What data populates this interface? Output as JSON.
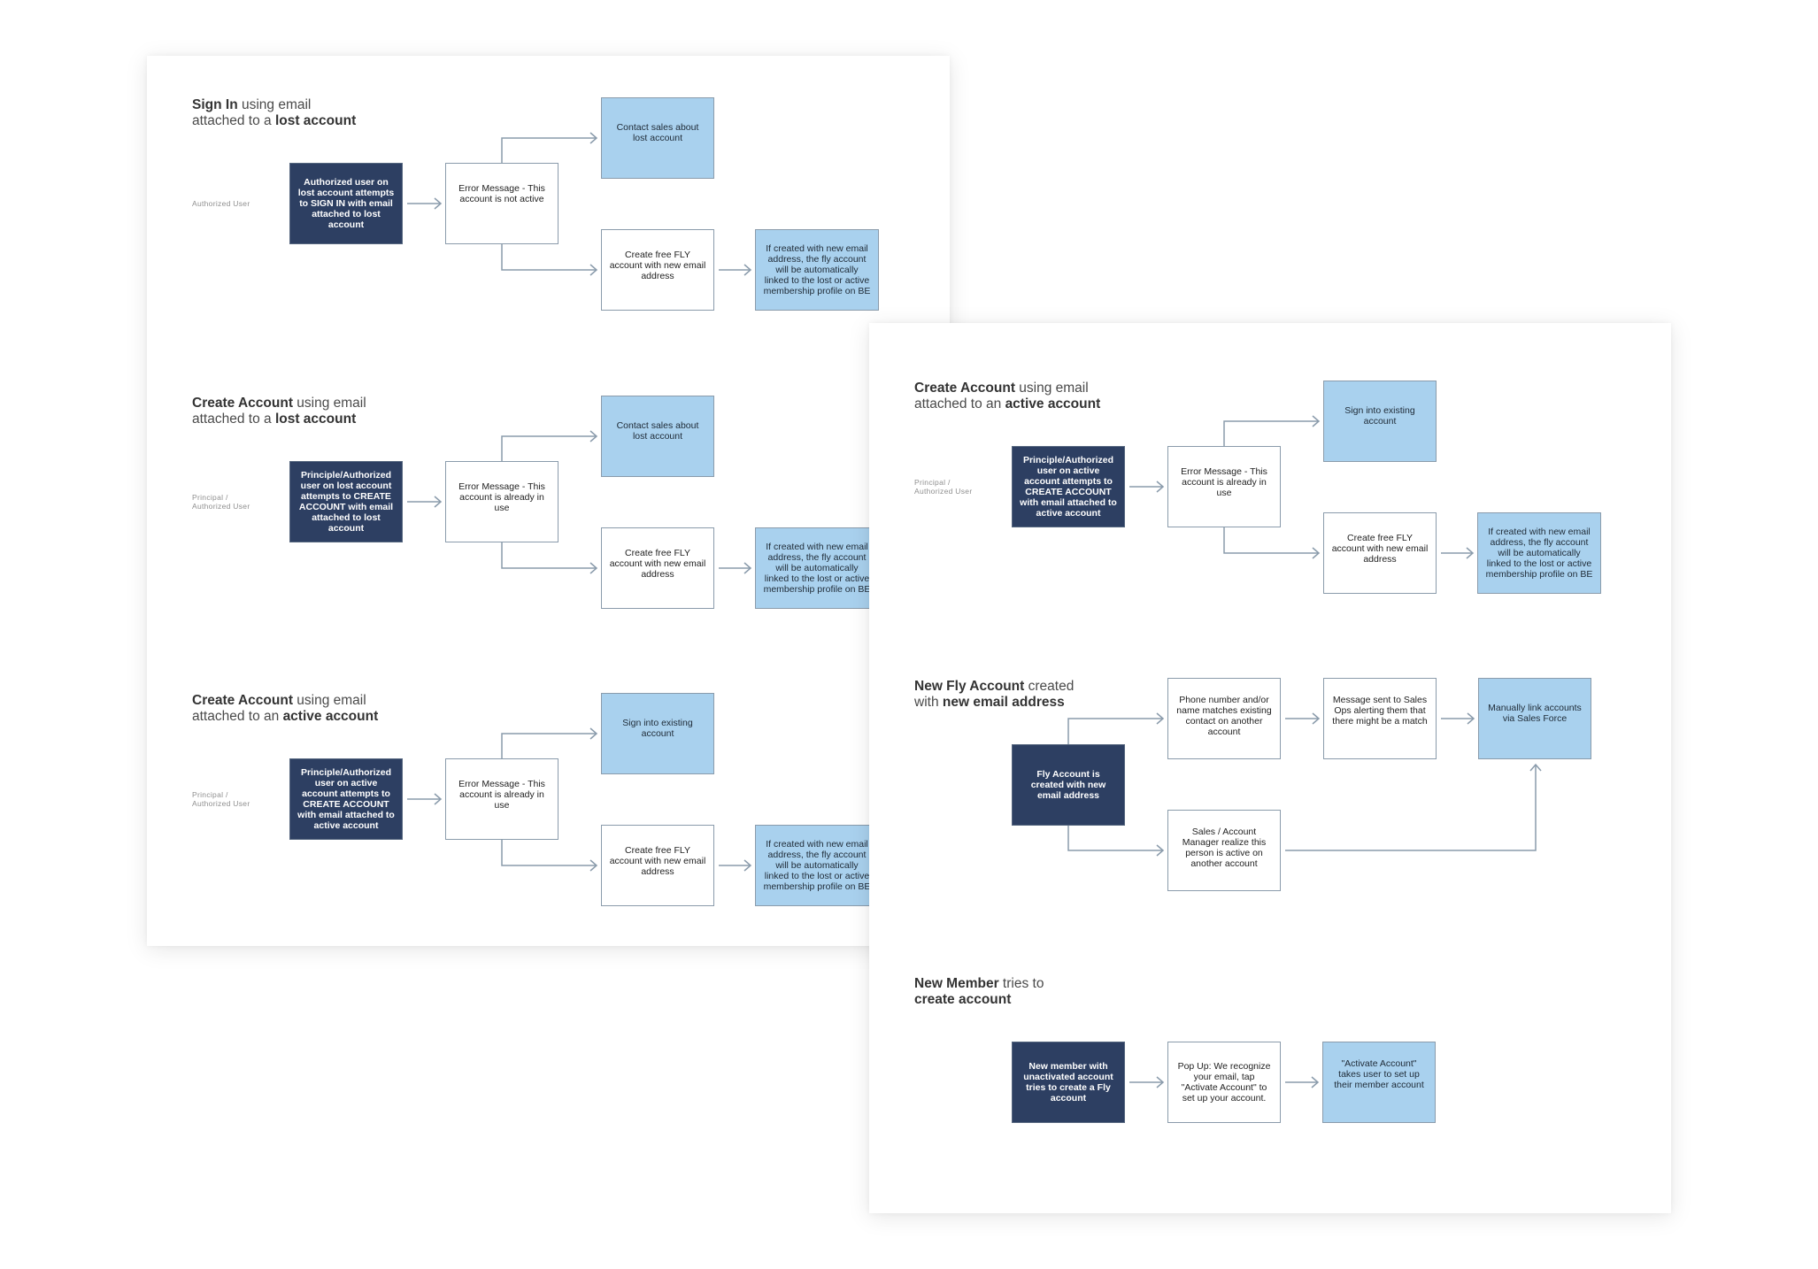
{
  "colors": {
    "dark_node": "#2d3f62",
    "light_node": "#a9d1ee",
    "connector": "#8a9bab"
  },
  "pages": [
    {
      "id": "left",
      "sections": [
        {
          "kind": "branch",
          "title": [
            [
              {
                "text": "Sign In",
                "bold": true
              },
              {
                "text": " using email",
                "bold": false
              }
            ],
            [
              {
                "text": "attached to a ",
                "bold": false
              },
              {
                "text": "lost account",
                "bold": true
              }
            ]
          ],
          "actor_label": "Authorized User",
          "nodes": {
            "start": {
              "style": "dark",
              "text": "Authorized user on lost account attempts to SIGN IN with email attached to lost account"
            },
            "error": {
              "style": "white",
              "text": "Error Message - This account is not active"
            },
            "top": {
              "style": "light",
              "text": "Contact sales about lost account"
            },
            "bottom": {
              "style": "white",
              "text": "Create free FLY account with new email address"
            },
            "result": {
              "style": "light",
              "text": "If created with new email address, the fly account will be automatically linked to the lost or active membership profile on BE"
            }
          }
        },
        {
          "kind": "branch",
          "title": [
            [
              {
                "text": "Create Account",
                "bold": true
              },
              {
                "text": " using email",
                "bold": false
              }
            ],
            [
              {
                "text": "attached to a ",
                "bold": false
              },
              {
                "text": "lost account",
                "bold": true
              }
            ]
          ],
          "actor_label": "Principal / Authorized User",
          "nodes": {
            "start": {
              "style": "dark",
              "text": "Principle/Authorized user on lost account attempts to CREATE ACCOUNT with email attached to lost account"
            },
            "error": {
              "style": "white",
              "text": "Error Message - This account is already in use"
            },
            "top": {
              "style": "light",
              "text": "Contact sales about lost account"
            },
            "bottom": {
              "style": "white",
              "text": "Create free FLY account with new email address"
            },
            "result": {
              "style": "light",
              "text": "If created with new email address, the fly account will be automatically linked to the lost or active membership profile on BE"
            }
          }
        },
        {
          "kind": "branch",
          "title": [
            [
              {
                "text": "Create Account",
                "bold": true
              },
              {
                "text": " using email",
                "bold": false
              }
            ],
            [
              {
                "text": "attached to an ",
                "bold": false
              },
              {
                "text": "active account",
                "bold": true
              }
            ]
          ],
          "actor_label": "Principal / Authorized User",
          "nodes": {
            "start": {
              "style": "dark",
              "text": "Principle/Authorized user on active account attempts to CREATE ACCOUNT with email attached to active account"
            },
            "error": {
              "style": "white",
              "text": "Error Message - This account is already in use"
            },
            "top": {
              "style": "light",
              "text": "Sign into existing account"
            },
            "bottom": {
              "style": "white",
              "text": "Create free FLY account with new email address"
            },
            "result": {
              "style": "light",
              "text": "If created with new email address, the fly account will be automatically linked to the lost or active membership profile on BE"
            }
          }
        }
      ]
    },
    {
      "id": "right",
      "sections": [
        {
          "kind": "branch",
          "title": [
            [
              {
                "text": "Create Account",
                "bold": true
              },
              {
                "text": " using email",
                "bold": false
              }
            ],
            [
              {
                "text": "attached to an ",
                "bold": false
              },
              {
                "text": "active account",
                "bold": true
              }
            ]
          ],
          "actor_label": "Principal / Authorized User",
          "nodes": {
            "start": {
              "style": "dark",
              "text": "Principle/Authorized user on active account attempts to CREATE ACCOUNT with email attached to active account"
            },
            "error": {
              "style": "white",
              "text": "Error Message - This account is already in use"
            },
            "top": {
              "style": "light",
              "text": "Sign into existing account"
            },
            "bottom": {
              "style": "white",
              "text": "Create free FLY account with new email address"
            },
            "result": {
              "style": "light",
              "text": "If created with new email address, the fly account will be automatically linked to the lost or active membership profile on BE"
            }
          }
        },
        {
          "kind": "fly",
          "title": [
            [
              {
                "text": "New Fly Account",
                "bold": true
              },
              {
                "text": " created",
                "bold": false
              }
            ],
            [
              {
                "text": "with ",
                "bold": false
              },
              {
                "text": "new email address",
                "bold": true
              }
            ]
          ],
          "actor_label": "",
          "nodes": {
            "start": {
              "style": "dark",
              "text": "Fly Account is created with new email address"
            },
            "match": {
              "style": "white",
              "text": "Phone number and/or name matches existing contact on another account"
            },
            "message": {
              "style": "white",
              "text": "Message sent to Sales Ops alerting them that there might be a match"
            },
            "link": {
              "style": "light",
              "text": "Manually link accounts via Sales Force"
            },
            "manager": {
              "style": "white",
              "text": "Sales / Account Manager realize this person is active on another account"
            }
          }
        },
        {
          "kind": "linear",
          "title": [
            [
              {
                "text": "New Member",
                "bold": true
              },
              {
                "text": " tries to",
                "bold": false
              }
            ],
            [
              {
                "text": "create account",
                "bold": true
              }
            ]
          ],
          "actor_label": "",
          "nodes": {
            "start": {
              "style": "dark",
              "text": "New member with unactivated account tries to create a Fly account"
            },
            "popup": {
              "style": "white",
              "text": "Pop Up: We recognize your email, tap \"Activate Account\" to set up your account."
            },
            "activate": {
              "style": "light",
              "text": "\"Activate Account\" takes user to set up their member account"
            }
          }
        }
      ]
    }
  ]
}
